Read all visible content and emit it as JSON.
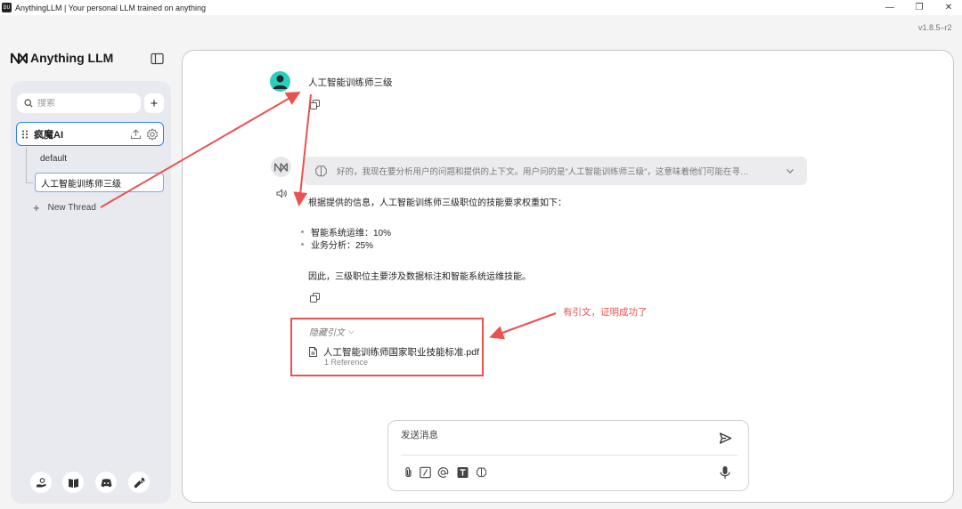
{
  "window": {
    "title": "AnythingLLM | Your personal LLM trained on anything",
    "app_icon_text": "DU",
    "controls": {
      "minimize": "—",
      "maximize": "❐",
      "close": "✕"
    }
  },
  "version": "v1.8.5–r2",
  "brand": {
    "name": "Anything LLM"
  },
  "sidebar": {
    "search_placeholder": "搜索",
    "new_workspace_label": "+",
    "workspace": {
      "name": "疯魔AI"
    },
    "threads": [
      {
        "label": "default",
        "active": false
      },
      {
        "label": "人工智能训练师三级",
        "active": true
      }
    ],
    "new_thread_label": "New Thread",
    "footer_icons": [
      "community-hub-icon",
      "docs-book-icon",
      "discord-icon",
      "settings-wrench-icon"
    ]
  },
  "chat": {
    "user_message": "人工智能训练师三级",
    "assistant": {
      "thought_preview": "好的，我现在要分析用户的问题和提供的上下文。用户问的是“人工智能训练师三级”，这意味着他们可能在寻…",
      "intro": "根据提供的信息，人工智能训练师三级职位的技能要求权重如下：",
      "bullets": [
        "智能系统运维：10%",
        "业务分析：25%"
      ],
      "conclusion": "因此，三级职位主要涉及数据标注和智能系统运维技能。",
      "citations": {
        "toggle_label": "隐藏引文",
        "file_name": "人工智能训练师国家职业技能标准.pdf",
        "reference_count": "1 Reference"
      }
    },
    "annotation": "有引文，证明成功了"
  },
  "composer": {
    "placeholder": "发送消息",
    "tools": [
      "attachment-icon",
      "slash-command-icon",
      "mention-icon",
      "text-format-icon",
      "agent-brain-icon"
    ]
  },
  "colors": {
    "accent_blue": "#2d7ff9",
    "annotation_red": "#e8524f",
    "avatar_teal": "#2bcfbe"
  }
}
